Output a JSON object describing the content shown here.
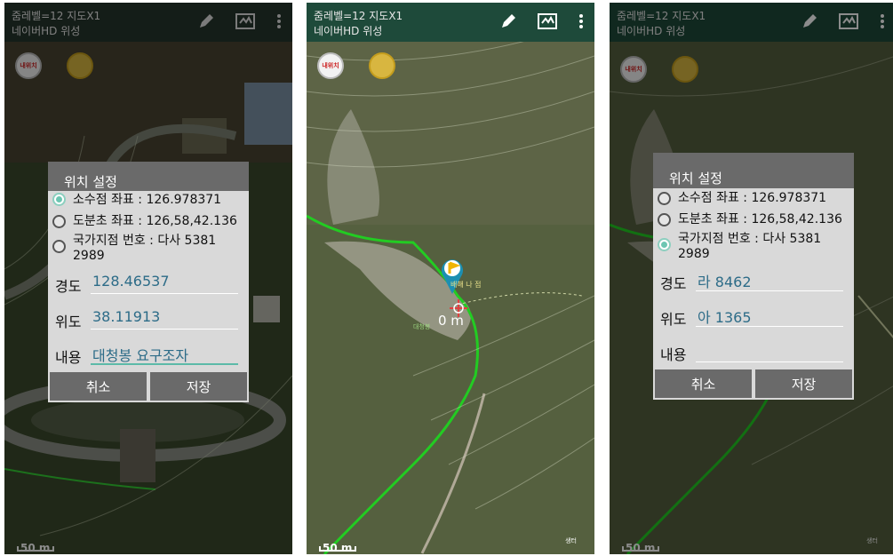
{
  "appbar": {
    "line1": "줌레벨=12 지도X1",
    "line2": "네이버HD 위성"
  },
  "map": {
    "my_location_label": "내위치",
    "scale_label": "50 m",
    "center_distance": "0 m",
    "point_marker_text": "배해 나 점",
    "point_sub_label": "대청봉",
    "center_poi_label": "생터"
  },
  "dialog1": {
    "title": "위치 설정",
    "opt_decimal": "소수점 좌표 : 126.978371",
    "opt_dms": "도분초 좌표 : 126,58,42.136",
    "opt_national": "국가지점 번호 : 다사 5381 2989",
    "longitude_label": "경도",
    "longitude_value": "128.46537",
    "latitude_label": "위도",
    "latitude_value": "38.11913",
    "content_label": "내용",
    "content_value": "대청봉 요구조자",
    "cancel": "취소",
    "save": "저장"
  },
  "dialog3": {
    "title": "위치 설정",
    "opt_decimal": "소수점 좌표 : 126.978371",
    "opt_dms": "도분초 좌표 : 126,58,42.136",
    "opt_national": "국가지점 번호 : 다사 5381 2989",
    "longitude_label": "경도",
    "longitude_value": "라 8462",
    "latitude_label": "위도",
    "latitude_value": "아 1365",
    "content_label": "내용",
    "content_value": "",
    "cancel": "취소",
    "save": "저장"
  },
  "icons": [
    "pencil-icon",
    "map-icon",
    "more-vert-icon",
    "my-location-icon",
    "layers-icon",
    "location-pin-icon",
    "crosshair-icon"
  ]
}
